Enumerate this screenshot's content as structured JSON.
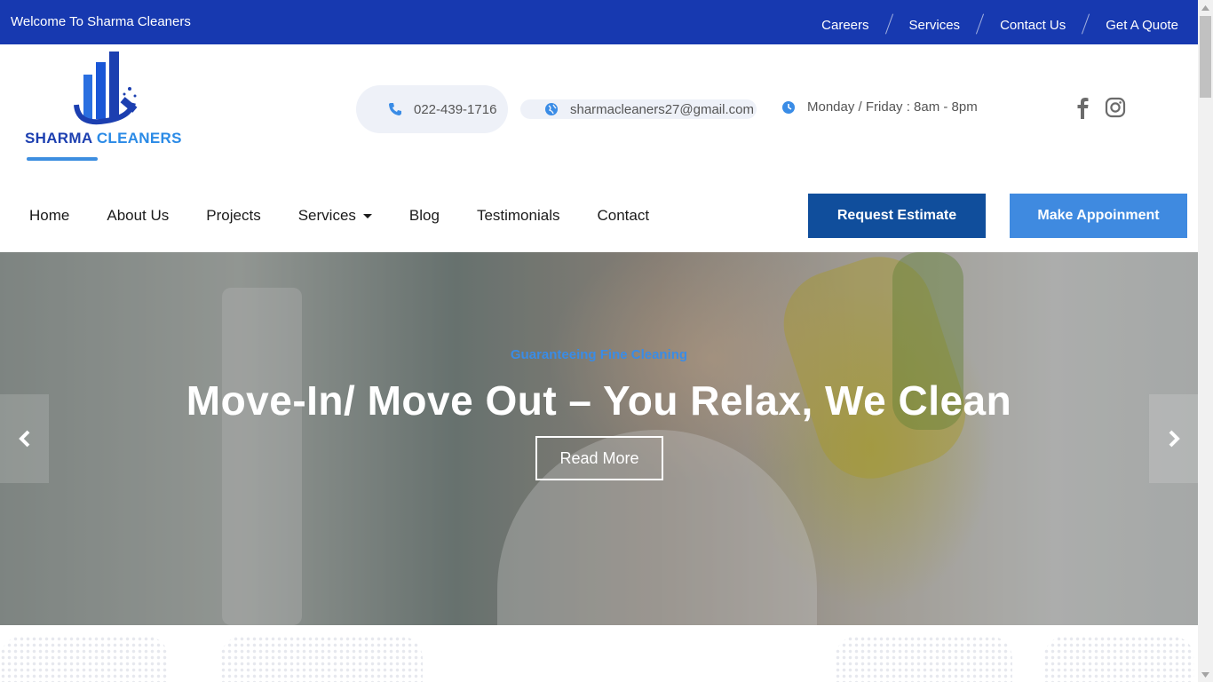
{
  "topbar": {
    "welcome": "Welcome To Sharma Cleaners",
    "links": [
      "Careers",
      "Services",
      "Contact Us",
      "Get A Quote"
    ]
  },
  "logo": {
    "part1": "SHARMA ",
    "part2": "CLEANERS"
  },
  "contact": {
    "phone": "022-439-1716",
    "email": "sharmacleaners27@gmail.com",
    "hours": "Monday / Friday : 8am - 8pm"
  },
  "social": [
    "facebook-icon",
    "instagram-icon"
  ],
  "nav": {
    "items": [
      "Home",
      "About Us",
      "Projects",
      "Services",
      "Blog",
      "Testimonials",
      "Contact"
    ]
  },
  "buttons": {
    "estimate": "Request Estimate",
    "appointment": "Make Appoinment"
  },
  "hero": {
    "subtitle": "Guaranteeing Fine Cleaning",
    "title": "Move-In/ Move Out – You Relax, We Clean",
    "cta": "Read More"
  },
  "colors": {
    "topbar": "#1739b0",
    "estimate": "#104e9c",
    "appointment": "#3f8ae0",
    "accent": "#3a8ce6"
  }
}
